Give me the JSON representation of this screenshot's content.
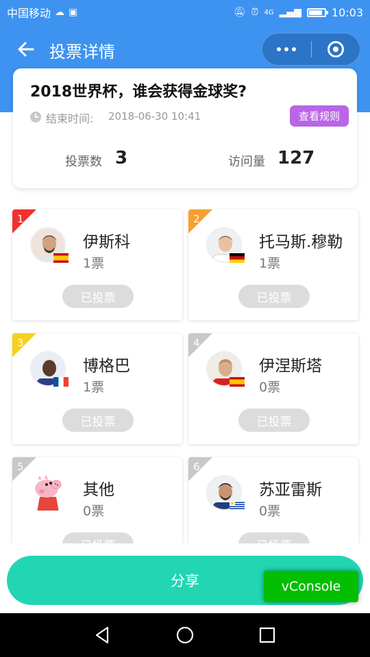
{
  "status_bar": {
    "carrier": "中国移动",
    "time": "10:03",
    "network": "4G",
    "battery_level": 0.85
  },
  "nav": {
    "title": "投票详情"
  },
  "vote": {
    "title": "2018世界杯，谁会获得金球奖?",
    "end_label": "结束时间:",
    "end_time": "2018-06-30 10:41",
    "rules_label": "查看规则",
    "count_label": "投票数",
    "count_value": "3",
    "visits_label": "访问量",
    "visits_value": "127"
  },
  "candidates": [
    {
      "rank": "1",
      "name": "伊斯科",
      "votes": "1票",
      "button": "已投票",
      "badge_color": "#f23030",
      "flag": "spain"
    },
    {
      "rank": "2",
      "name": "托马斯.穆勒",
      "votes": "1票",
      "button": "已投票",
      "badge_color": "#f5a030",
      "flag": "germany"
    },
    {
      "rank": "3",
      "name": "博格巴",
      "votes": "1票",
      "button": "已投票",
      "badge_color": "#f5d020",
      "flag": "france"
    },
    {
      "rank": "4",
      "name": "伊涅斯塔",
      "votes": "0票",
      "button": "已投票",
      "badge_color": "#c8c8c8",
      "flag": "spain"
    },
    {
      "rank": "5",
      "name": "其他",
      "votes": "0票",
      "button": "已投票",
      "badge_color": "#c8c8c8",
      "flag": "none"
    },
    {
      "rank": "6",
      "name": "苏亚雷斯",
      "votes": "0票",
      "button": "已投票",
      "badge_color": "#c8c8c8",
      "flag": "uruguay"
    }
  ],
  "share_label": "分享",
  "vconsole_label": "vConsole",
  "colors": {
    "primary": "#3e93f0",
    "rules": "#b966e6",
    "share": "#22d6b3",
    "vconsole": "#04be02"
  }
}
